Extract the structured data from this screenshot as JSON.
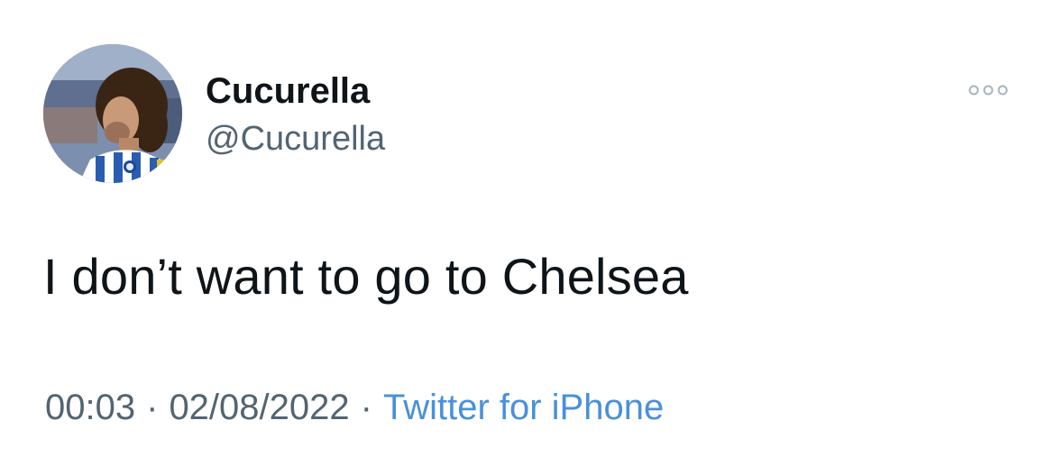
{
  "tweet": {
    "author": {
      "display_name": "Cucurella",
      "handle": "@Cucurella",
      "avatar_icon": "profile-photo-avatar"
    },
    "text": "I don’t want to go to Chelsea",
    "time": "00:03",
    "date": "02/08/2022",
    "separator": "·",
    "source": "Twitter for iPhone",
    "more_icon": "more-options-icon"
  },
  "colors": {
    "text_primary": "#0f1419",
    "text_secondary": "#536471",
    "link": "#4a90d9",
    "background": "#ffffff"
  }
}
